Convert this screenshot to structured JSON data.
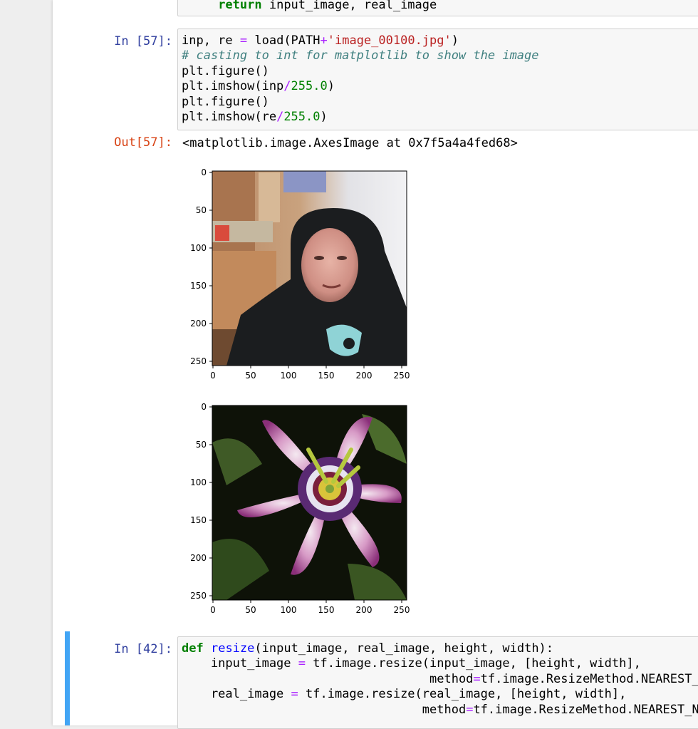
{
  "cells": {
    "prev_tail": {
      "kw": "return",
      "rest": " input_image, real_image"
    },
    "cell57": {
      "prompt_in": "In [57]:",
      "l1_a": "inp, re ",
      "l1_eq": "=",
      "l1_b": " load(PATH",
      "l1_plus": "+",
      "l1_str": "'image_00100.jpg'",
      "l1_c": ")",
      "l2_comment": "# casting to int for matplotlib to show the image",
      "l3": "plt.figure()",
      "l4_a": "plt.imshow(inp",
      "l4_op": "/",
      "l4_num": "255.0",
      "l4_b": ")",
      "l5": "plt.figure()",
      "l6_a": "plt.imshow(re",
      "l6_op": "/",
      "l6_num": "255.0",
      "l6_b": ")",
      "prompt_out": "Out[57]:",
      "output_text": "<matplotlib.image.AxesImage at 0x7f5a4a4fed68>"
    },
    "cell42": {
      "prompt_in": "In [42]:",
      "l1_kw": "def",
      "l1_fn": "resize",
      "l1_rest": "(input_image, real_image, height, width):",
      "l2_a": "    input_image ",
      "l2_eq": "=",
      "l2_b": " tf.image.resize(input_image, [height, width],",
      "l3_pad": "                                  ",
      "l3_a": "method",
      "l3_eq": "=",
      "l3_b": "tf.image.ResizeMethod.NEAREST_NEIGHBOR)",
      "l4_a": "    real_image ",
      "l4_eq": "=",
      "l4_b": " tf.image.resize(real_image, [height, width],",
      "l5_pad": "                                 ",
      "l5_a": "method",
      "l5_eq": "=",
      "l5_b": "tf.image.ResizeMethod.NEAREST_NEIGHBOR)"
    }
  },
  "plots": {
    "plot1": {
      "image": "webcam-portrait-hooded-person",
      "y_ticks": [
        "0",
        "50",
        "100",
        "150",
        "200",
        "250"
      ],
      "x_ticks": [
        "0",
        "50",
        "100",
        "150",
        "200",
        "250"
      ]
    },
    "plot2": {
      "image": "passion-flower-closeup",
      "y_ticks": [
        "0",
        "50",
        "100",
        "150",
        "200",
        "250"
      ],
      "x_ticks": [
        "0",
        "50",
        "100",
        "150",
        "200",
        "250"
      ]
    }
  },
  "colors": {
    "prompt_in": "#303f9f",
    "prompt_out": "#d84315",
    "selection_bar": "#42a5f5"
  }
}
